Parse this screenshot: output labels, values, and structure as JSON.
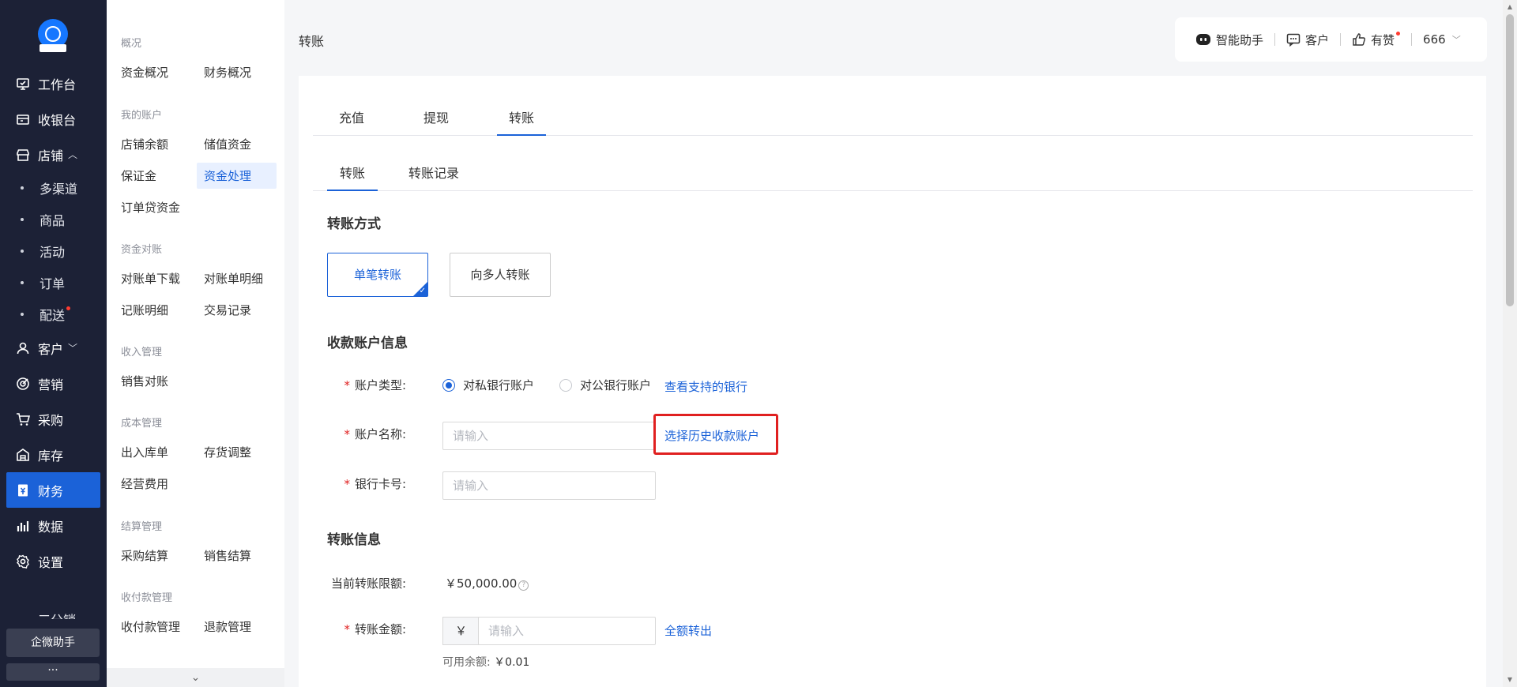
{
  "nav": {
    "items": [
      {
        "label": "工作台",
        "icon": "workbench-icon"
      },
      {
        "label": "收银台",
        "icon": "cashier-icon"
      },
      {
        "label": "店铺",
        "icon": "store-icon",
        "caret": "︿"
      },
      {
        "label": "多渠道",
        "sub": true
      },
      {
        "label": "商品",
        "sub": true
      },
      {
        "label": "活动",
        "sub": true
      },
      {
        "label": "订单",
        "sub": true
      },
      {
        "label": "配送",
        "sub": true,
        "badge": true
      },
      {
        "label": "客户",
        "icon": "customer-icon",
        "caret": "﹀"
      },
      {
        "label": "营销",
        "icon": "marketing-icon"
      },
      {
        "label": "采购",
        "icon": "cart-icon"
      },
      {
        "label": "库存",
        "icon": "inventory-icon"
      },
      {
        "label": "财务",
        "icon": "finance-icon",
        "active": true
      },
      {
        "label": "数据",
        "icon": "chart-icon"
      },
      {
        "label": "设置",
        "icon": "gear-icon"
      }
    ],
    "partial_item": "三分销",
    "wechat_assistant": "企微助手",
    "more": "···"
  },
  "submenu": {
    "groups": [
      {
        "title": "概况",
        "items": [
          "资金概况",
          "财务概况"
        ]
      },
      {
        "title": "我的账户",
        "items": [
          "店铺余额",
          "储值资金",
          "保证金",
          "资金处理",
          "订单贷资金"
        ]
      },
      {
        "title": "资金对账",
        "items": [
          "对账单下载",
          "对账单明细",
          "记账明细",
          "交易记录"
        ]
      },
      {
        "title": "收入管理",
        "items": [
          "销售对账"
        ]
      },
      {
        "title": "成本管理",
        "items": [
          "出入库单",
          "存货调整",
          "经营费用"
        ]
      },
      {
        "title": "结算管理",
        "items": [
          "采购结算",
          "销售结算"
        ]
      },
      {
        "title": "收付款管理",
        "items": [
          "收付款管理",
          "退款管理"
        ]
      }
    ],
    "active": "资金处理",
    "collapse": "⌄"
  },
  "header": {
    "title": "转账",
    "assistant": "智能助手",
    "customer": "客户",
    "likes": "有赞",
    "user": "666"
  },
  "tabs_primary": [
    "充值",
    "提现",
    "转账"
  ],
  "tabs_primary_active": "转账",
  "tabs_secondary": [
    "转账",
    "转账记录"
  ],
  "tabs_secondary_active": "转账",
  "form": {
    "method_title": "转账方式",
    "method_single": "单笔转账",
    "method_multi": "向多人转账",
    "payee_title": "收款账户信息",
    "account_type_label": "账户类型:",
    "account_type_private": "对私银行账户",
    "account_type_public": "对公银行账户",
    "supported_banks_link": "查看支持的银行",
    "account_name_label": "账户名称:",
    "account_name_placeholder": "请输入",
    "history_account_link": "选择历史收款账户",
    "card_no_label": "银行卡号:",
    "card_no_placeholder": "请输入",
    "transfer_title": "转账信息",
    "limit_label": "当前转账限额:",
    "limit_value": "￥50,000.00",
    "amount_label": "转账金额:",
    "amount_prefix": "￥",
    "amount_placeholder": "请输入",
    "transfer_all_link": "全额转出",
    "available_label": "可用余额:",
    "available_value": "￥0.01",
    "required_mark": "*"
  },
  "colors": {
    "nav_bg": "#1c2136",
    "accent": "#1b62d8",
    "highlight": "#e02020"
  }
}
